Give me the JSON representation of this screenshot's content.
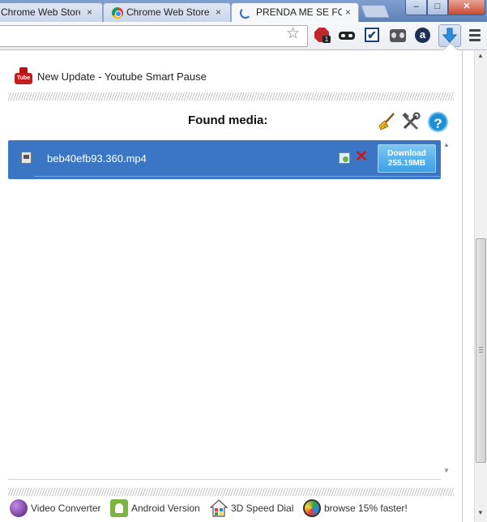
{
  "tabs": [
    {
      "title": "Chrome Web Store",
      "close": "×",
      "active": false
    },
    {
      "title": "Chrome Web Store",
      "close": "×",
      "active": false
    },
    {
      "title": "PRENDA ME SE FOR",
      "close": "×",
      "active": true
    }
  ],
  "window_controls": {
    "minimize": "–",
    "maximize": "□",
    "close": "✕"
  },
  "toolbar": {
    "star_glyph": "☆",
    "adblock_badge": "1",
    "check_glyph": "✔",
    "amazon_glyph": "a",
    "extensions": [
      "adblock-icon",
      "mask-icon",
      "checkmark-icon",
      "ghostery-icon",
      "amazon-icon",
      "download-helper-icon",
      "menu-icon"
    ]
  },
  "popup": {
    "update_text": "New Update - Youtube Smart Pause",
    "youtube_icon_text": "Tube",
    "found_media_label": "Found media:",
    "help_glyph": "?",
    "media_items": [
      {
        "filename": "beb40efb93.360.mp4",
        "delete_glyph": "✕",
        "download_label": "Download",
        "download_size": "255.19MB"
      }
    ],
    "footer": [
      {
        "label": "Video Converter",
        "icon": "video-converter-icon"
      },
      {
        "label": "Android Version",
        "icon": "android-icon"
      },
      {
        "label": "3D Speed Dial",
        "icon": "speed-dial-icon"
      },
      {
        "label": "browse 15% faster!",
        "icon": "browser-speed-icon"
      }
    ]
  },
  "colors": {
    "media_row": "#3b76c4",
    "download_button": "#3aa1e4",
    "help_icon": "#1e8fd6",
    "delete": "#d21515"
  }
}
